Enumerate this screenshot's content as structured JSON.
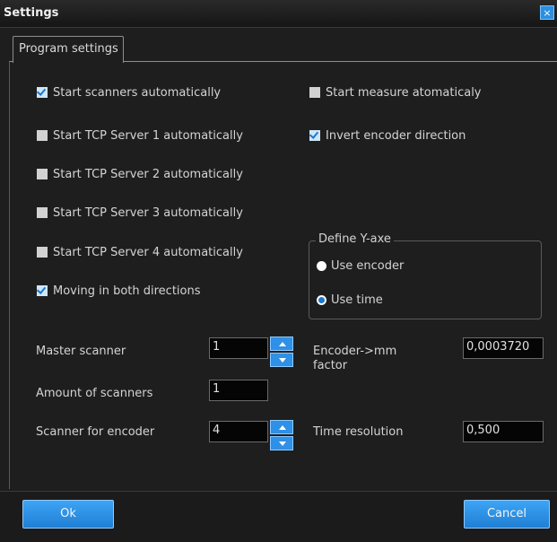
{
  "window": {
    "title": "Settings",
    "close_glyph": "×"
  },
  "tab": {
    "label": "Program settings"
  },
  "checkboxes_left": [
    {
      "label": "Start scanners automatically",
      "checked": true
    },
    {
      "label": "Start TCP Server 1  automatically",
      "checked": false
    },
    {
      "label": "Start TCP Server 2  automatically",
      "checked": false
    },
    {
      "label": "Start TCP Server 3  automatically",
      "checked": false
    },
    {
      "label": "Start TCP Server 4  automatically",
      "checked": false
    },
    {
      "label": "Moving in both directions",
      "checked": true
    }
  ],
  "checkboxes_right": [
    {
      "label": "Start measure atomaticaly",
      "checked": false
    },
    {
      "label": "Invert encoder direction",
      "checked": true
    }
  ],
  "y_axis": {
    "legend": "Define Y-axe",
    "options": [
      {
        "label": "Use encoder",
        "selected": false
      },
      {
        "label": "Use time",
        "selected": true
      }
    ]
  },
  "fields": {
    "master_scanner": {
      "label": "Master scanner",
      "value": "1"
    },
    "amount_scanners": {
      "label": "Amount of scanners",
      "value": "1"
    },
    "scanner_encoder": {
      "label": "Scanner for encoder",
      "value": "4"
    },
    "encoder_factor": {
      "label": "Encoder->mm factor",
      "value": "0,0003720"
    },
    "time_resolution": {
      "label": "Time resolution",
      "value": "0,500"
    }
  },
  "buttons": {
    "ok": "Ok",
    "cancel": "Cancel"
  },
  "colors": {
    "accent": "#2e90e6",
    "background": "#1e1e1e"
  }
}
